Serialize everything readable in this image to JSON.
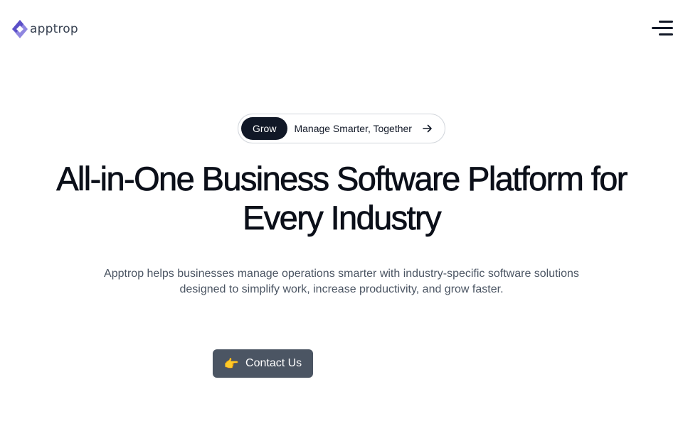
{
  "header": {
    "logo_text": "apptrop",
    "menu_icon": "menu-icon"
  },
  "hero": {
    "pill": {
      "badge": "Grow",
      "text": "Manage Smarter, Together",
      "icon": "arrow-right-icon"
    },
    "headline_line1": "All-in-One Business Software Platform for",
    "headline_line2": "Every Industry",
    "subtitle_line1": "Apptrop helps businesses manage operations smarter with industry-specific software solutions",
    "subtitle_line2": "designed to simplify work, increase productivity, and grow faster.",
    "cta": {
      "icon": "👉",
      "label": "Contact Us"
    }
  },
  "colors": {
    "brand_primary": "#5b4fc7",
    "brand_secondary": "#8f86e0",
    "dark": "#111827",
    "cta_bg": "#4b5563"
  }
}
